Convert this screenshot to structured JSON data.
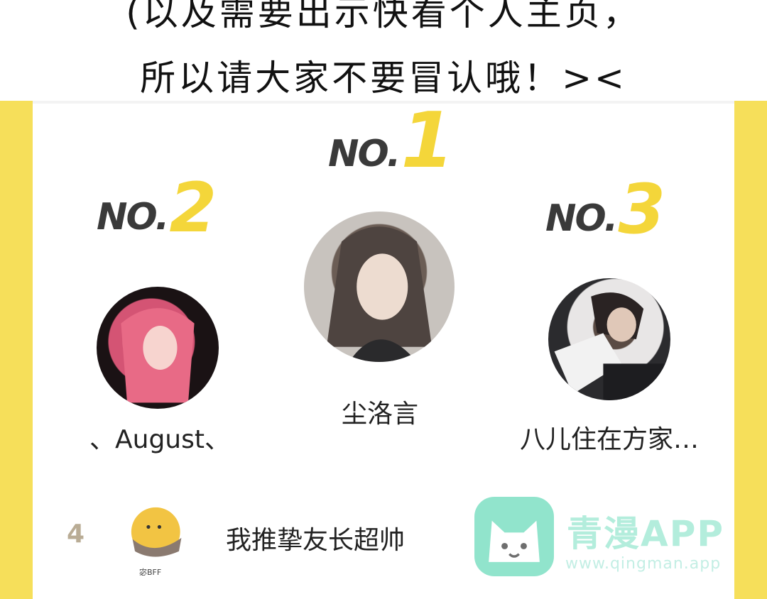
{
  "banner": {
    "line1": "(以及需要出示快看个人主页，",
    "line2": "所以请大家不要冒认哦！><"
  },
  "podium": [
    {
      "no_text": "NO.",
      "rank": "1",
      "name": "尘洛言"
    },
    {
      "no_text": "NO.",
      "rank": "2",
      "name": "、August、"
    },
    {
      "no_text": "NO.",
      "rank": "3",
      "name": "八儿住在方家…"
    }
  ],
  "row4": {
    "rank": "4",
    "badge_caption": "宓BFF",
    "name": "我推挚友长超帅"
  },
  "watermark": {
    "title": "青漫APP",
    "url": "www.qingman.app"
  },
  "colors": {
    "accent_yellow": "#f4d63a",
    "frame_yellow": "#f6df5a",
    "rank_text": "#3a3a3a",
    "watermark_green": "#7ee0c4"
  }
}
